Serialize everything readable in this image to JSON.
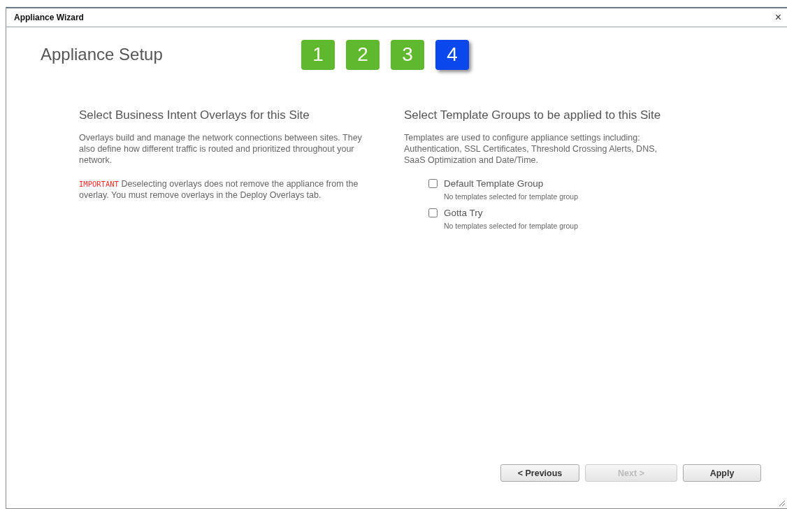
{
  "window": {
    "title": "Appliance Wizard",
    "close": "×"
  },
  "header": {
    "title": "Appliance Setup",
    "steps": [
      {
        "label": "1",
        "selected": false
      },
      {
        "label": "2",
        "selected": false
      },
      {
        "label": "3",
        "selected": false
      },
      {
        "label": "4",
        "selected": true
      }
    ]
  },
  "overlays": {
    "heading": "Select Business Intent Overlays for this Site",
    "description": "Overlays build and manage the network connections between sites. They also define how different traffic is routed and prioritized throughout your network.",
    "important_tag": "IMPORTANT",
    "important_text": "Deselecting overlays does not remove the appliance from the overlay. You must remove overlays in the Deploy Overlays tab."
  },
  "templates": {
    "heading": "Select Template Groups to be applied to this Site",
    "description": "Templates are used to configure appliance settings including: Authentication, SSL Certificates, Threshold Crossing Alerts, DNS, SaaS Optimization and Date/Time.",
    "groups": [
      {
        "label": "Default Template Group",
        "checked": false,
        "note": "No templates selected for template group"
      },
      {
        "label": "Gotta Try",
        "checked": false,
        "note": "No templates selected for template group"
      }
    ]
  },
  "buttons": [
    {
      "label": "< Previous",
      "disabled": false
    },
    {
      "label": "Next >",
      "disabled": true
    },
    {
      "label": "Apply",
      "disabled": false
    }
  ]
}
